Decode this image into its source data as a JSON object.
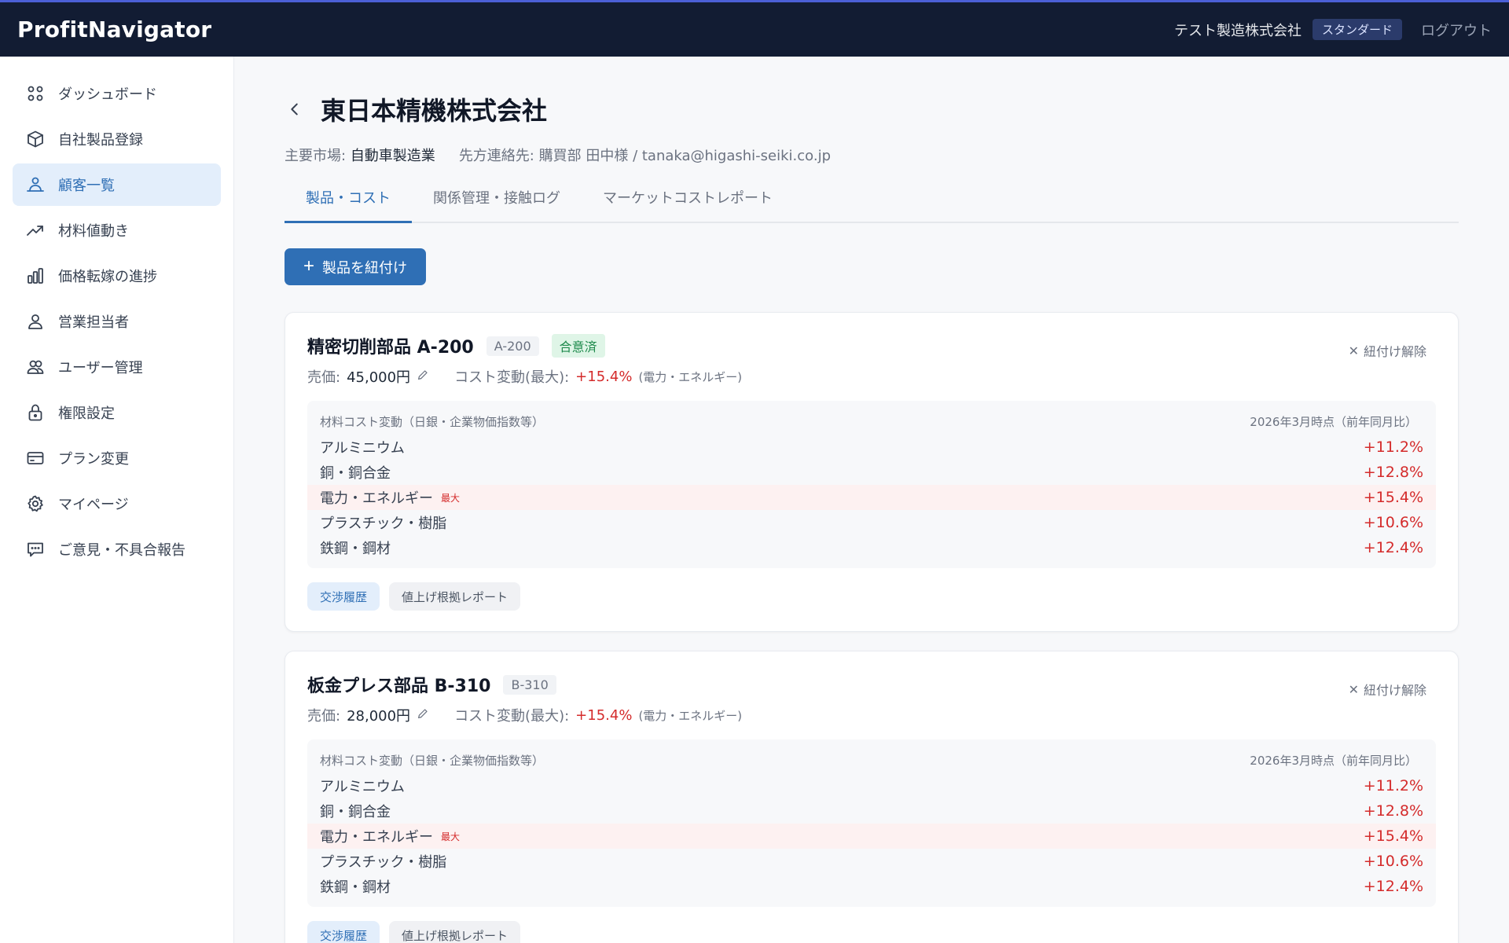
{
  "app": {
    "brand": "ProfitNavigator",
    "company": "テスト製造株式会社",
    "plan": "スタンダード",
    "logout": "ログアウト"
  },
  "sidebar": {
    "items": [
      {
        "label": "ダッシュボード",
        "icon": "grid-icon"
      },
      {
        "label": "自社製品登録",
        "icon": "box-icon"
      },
      {
        "label": "顧客一覧",
        "icon": "customers-icon",
        "active": true
      },
      {
        "label": "材料値動き",
        "icon": "trend-up-icon"
      },
      {
        "label": "価格転嫁の進捗",
        "icon": "bar-chart-icon"
      },
      {
        "label": "営業担当者",
        "icon": "person-icon"
      },
      {
        "label": "ユーザー管理",
        "icon": "users-icon"
      },
      {
        "label": "権限設定",
        "icon": "lock-icon"
      },
      {
        "label": "プラン変更",
        "icon": "credit-card-icon"
      },
      {
        "label": "マイページ",
        "icon": "gear-icon"
      },
      {
        "label": "ご意見・不具合報告",
        "icon": "chat-icon"
      }
    ]
  },
  "page": {
    "title": "東日本精機株式会社",
    "market_label": "主要市場:",
    "market_value": "自動車製造業",
    "contact_label": "先方連絡先:",
    "contact_value": "購買部 田中様 / tanaka@higashi-seiki.co.jp"
  },
  "tabs": [
    {
      "label": "製品・コスト",
      "active": true
    },
    {
      "label": "関係管理・接触ログ"
    },
    {
      "label": "マーケットコストレポート"
    }
  ],
  "add_button": {
    "plus": "+",
    "label": "製品を紐付け"
  },
  "cards": [
    {
      "name": "精密切削部品 A-200",
      "code": "A-200",
      "status": "合意済",
      "unlink": "紐付け解除",
      "price_label": "売価:",
      "price": "45,000円",
      "cost_label": "コスト変動(最大):",
      "cost_value": "+15.4%",
      "cost_note": "(電力・エネルギー)",
      "materials_header": "材料コスト変動（日銀・企業物価指数等）",
      "materials_date": "2026年3月時点（前年同月比）",
      "max_tag": "最大",
      "materials": [
        {
          "name": "アルミニウム",
          "pct": "+11.2%"
        },
        {
          "name": "銅・銅合金",
          "pct": "+12.8%"
        },
        {
          "name": "電力・エネルギー",
          "pct": "+15.4%",
          "max": true
        },
        {
          "name": "プラスチック・樹脂",
          "pct": "+10.6%"
        },
        {
          "name": "鉄鋼・鋼材",
          "pct": "+12.4%"
        }
      ],
      "action_history": "交渉履歴",
      "action_report": "値上げ根拠レポート"
    },
    {
      "name": "板金プレス部品 B-310",
      "code": "B-310",
      "status": "",
      "unlink": "紐付け解除",
      "price_label": "売価:",
      "price": "28,000円",
      "cost_label": "コスト変動(最大):",
      "cost_value": "+15.4%",
      "cost_note": "(電力・エネルギー)",
      "materials_header": "材料コスト変動（日銀・企業物価指数等）",
      "materials_date": "2026年3月時点（前年同月比）",
      "max_tag": "最大",
      "materials": [
        {
          "name": "アルミニウム",
          "pct": "+11.2%"
        },
        {
          "name": "銅・銅合金",
          "pct": "+12.8%"
        },
        {
          "name": "電力・エネルギー",
          "pct": "+15.4%",
          "max": true
        },
        {
          "name": "プラスチック・樹脂",
          "pct": "+10.6%"
        },
        {
          "name": "鉄鋼・鋼材",
          "pct": "+12.4%"
        }
      ],
      "action_history": "交渉履歴",
      "action_report": "値上げ根拠レポート"
    }
  ]
}
